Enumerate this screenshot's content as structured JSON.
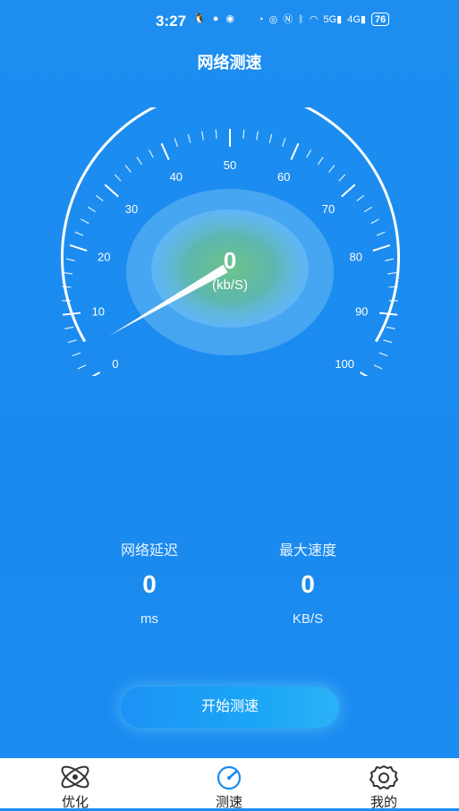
{
  "status_bar": {
    "time": "3:27",
    "network": "5G",
    "network2": "4G",
    "battery": "76"
  },
  "header": {
    "title": "网络测速"
  },
  "gauge": {
    "ticks": [
      "0",
      "10",
      "20",
      "30",
      "40",
      "50",
      "60",
      "70",
      "80",
      "90",
      "100"
    ],
    "value": "0",
    "unit": "(kb/S)",
    "current_speed": 0
  },
  "metrics": {
    "latency": {
      "label": "网络延迟",
      "value": "0",
      "unit": "ms"
    },
    "max_speed": {
      "label": "最大速度",
      "value": "0",
      "unit": "KB/S"
    }
  },
  "actions": {
    "start_label": "开始测速"
  },
  "nav": {
    "items": [
      {
        "label": "优化",
        "icon": "atom-icon"
      },
      {
        "label": "测速",
        "icon": "speedometer-icon",
        "active": true
      },
      {
        "label": "我的",
        "icon": "gear-icon"
      }
    ]
  },
  "colors": {
    "background": "#1b8cf0",
    "active_nav": "#1a8aef"
  }
}
